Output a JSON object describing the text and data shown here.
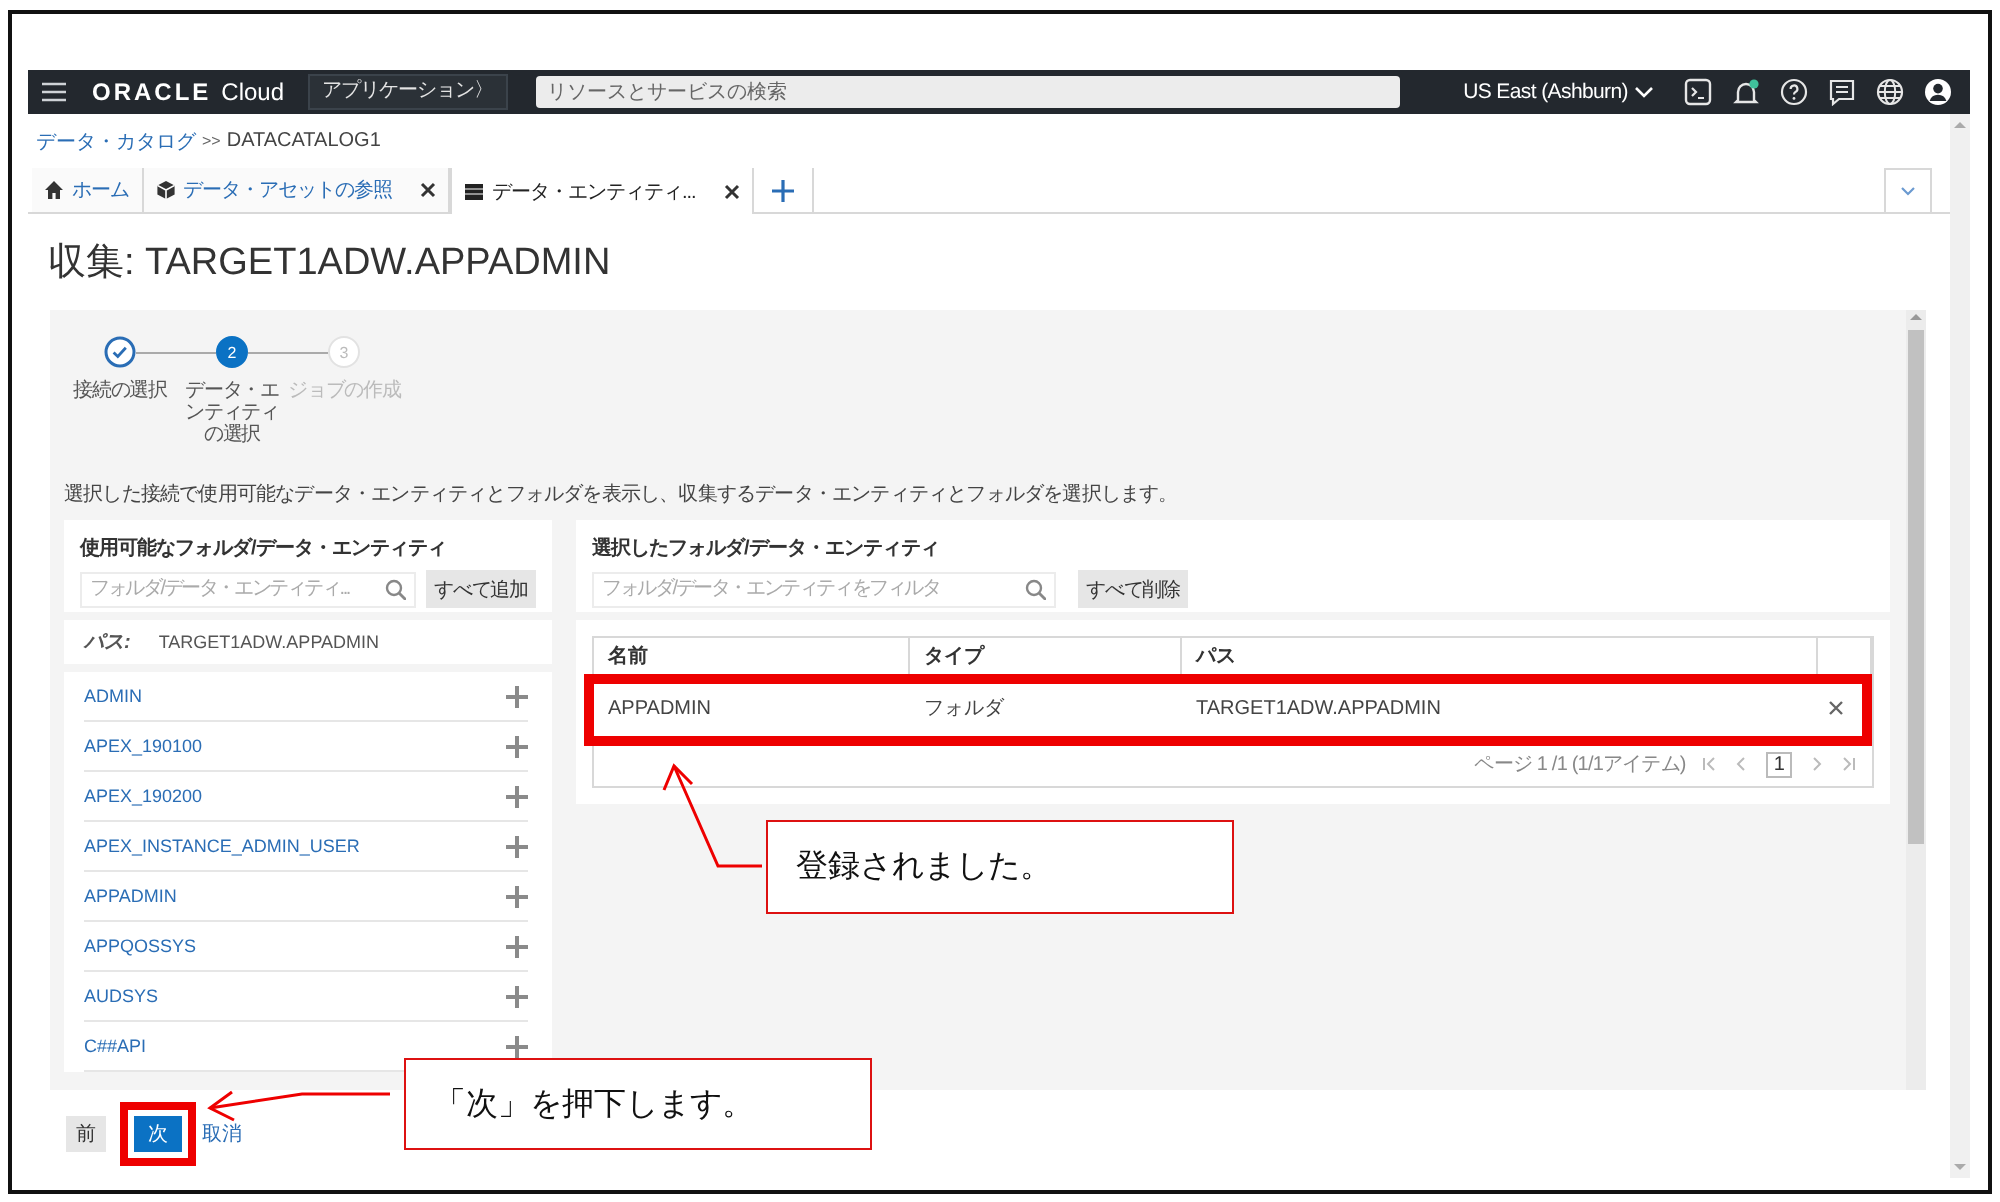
{
  "header": {
    "logo": "ORACLE",
    "product": "Cloud",
    "apps_button": "アプリケーション〉",
    "search": {
      "placeholder": "リソースとサービスの検索"
    },
    "region": "US East (Ashburn)"
  },
  "breadcrumb": {
    "link": "データ・カタログ",
    "separator": ">>",
    "current": "DATACATALOG1"
  },
  "tabs": [
    {
      "label": "ホーム",
      "kind": "home",
      "selected": false,
      "closable": false
    },
    {
      "label": "データ・アセットの参照",
      "kind": "browse",
      "selected": false,
      "closable": true
    },
    {
      "label": "データ・エンティティ...",
      "kind": "entity",
      "selected": true,
      "closable": true
    }
  ],
  "page_title": "収集: TARGET1ADW.APPADMIN",
  "wizard": {
    "steps": [
      {
        "label": "接続の選択",
        "completed": true,
        "selected": false
      },
      {
        "number": "2",
        "label": "データ・エンティティの選択",
        "completed": false,
        "selected": true
      },
      {
        "number": "3",
        "label": "ジョブの作成",
        "completed": false,
        "selected": false
      }
    ],
    "description": "選択した接続で使用可能なデータ・エンティティとフォルダを表示し、収集するデータ・エンティティとフォルダを選択します。"
  },
  "available": {
    "title": "使用可能なフォルダ/データ・エンティティ",
    "filter": {
      "placeholder": "フォルダ/データ・エンティティ..."
    },
    "add_all": "すべて追加",
    "path_label": "パス:",
    "path": "TARGET1ADW.APPADMIN",
    "items": [
      "ADMIN",
      "APEX_190100",
      "APEX_190200",
      "APEX_INSTANCE_ADMIN_USER",
      "APPADMIN",
      "APPQOSSYS",
      "AUDSYS",
      "C##API"
    ]
  },
  "selected": {
    "title": "選択したフォルダ/データ・エンティティ",
    "filter": {
      "placeholder": "フォルダ/データ・エンティティをフィルタ"
    },
    "remove_all": "すべて削除",
    "table": {
      "columns": [
        "名前",
        "タイプ",
        "パス"
      ],
      "rows": [
        {
          "cells": [
            "APPADMIN",
            "フォルダ",
            "TARGET1ADW.APPADMIN"
          ]
        }
      ]
    },
    "pagination": {
      "summary": "ページ 1 /1 (1/1アイテム)",
      "page": "1"
    }
  },
  "footer": {
    "buttons": [
      {
        "label": "前",
        "kind": "secondary"
      },
      {
        "label": "次",
        "kind": "primary"
      },
      {
        "label": "取消",
        "kind": "link"
      }
    ]
  },
  "annotations": [
    {
      "text": "登録されました。",
      "kind": "row"
    },
    {
      "text": "「次」を押下します。",
      "kind": "button"
    }
  ]
}
